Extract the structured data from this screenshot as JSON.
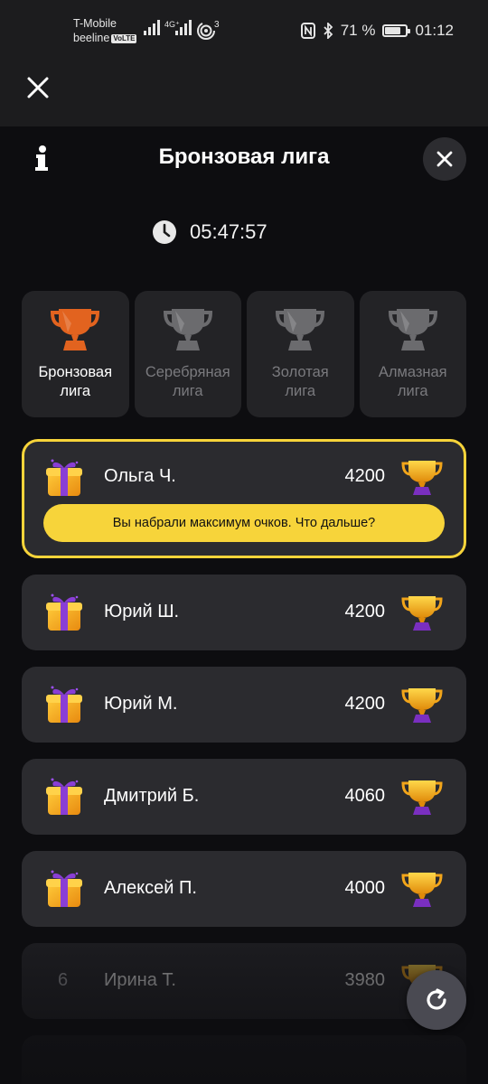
{
  "statusbar": {
    "carrier1": "T-Mobile",
    "carrier2": "beeline",
    "volte": "VoLTE",
    "net": "4G⁺",
    "hotspot_count": "3",
    "battery": "71 %",
    "battery_level": 0.71,
    "time": "01:12"
  },
  "header": {
    "title": "Бронзовая лига",
    "timer": "05:47:57"
  },
  "leagues": [
    {
      "line1": "Бронзовая",
      "line2": "лига",
      "color": "#e2631f",
      "active": true
    },
    {
      "line1": "Серебряная",
      "line2": "лига",
      "color": "#6b6b6e",
      "active": false
    },
    {
      "line1": "Золотая",
      "line2": "лига",
      "color": "#6b6b6e",
      "active": false
    },
    {
      "line1": "Алмазная",
      "line2": "лига",
      "color": "#6b6b6e",
      "active": false
    }
  ],
  "current_user": {
    "name": "Ольга Ч.",
    "score": "4200",
    "banner": "Вы набрали максимум очков. Что дальше?"
  },
  "rows": [
    {
      "name": "Юрий Ш.",
      "score": "4200"
    },
    {
      "name": "Юрий М.",
      "score": "4200"
    },
    {
      "name": "Дмитрий Б.",
      "score": "4060"
    },
    {
      "name": "Алексей П.",
      "score": "4000"
    },
    {
      "rank": "6",
      "name": "Ирина Т.",
      "score": "3980"
    }
  ],
  "colors": {
    "accent": "#f7d43a",
    "background": "#0d0d10",
    "card": "#2b2b2f",
    "bronze": "#e2631f",
    "gold": "#f4a81c",
    "purple": "#7a2fc0"
  }
}
